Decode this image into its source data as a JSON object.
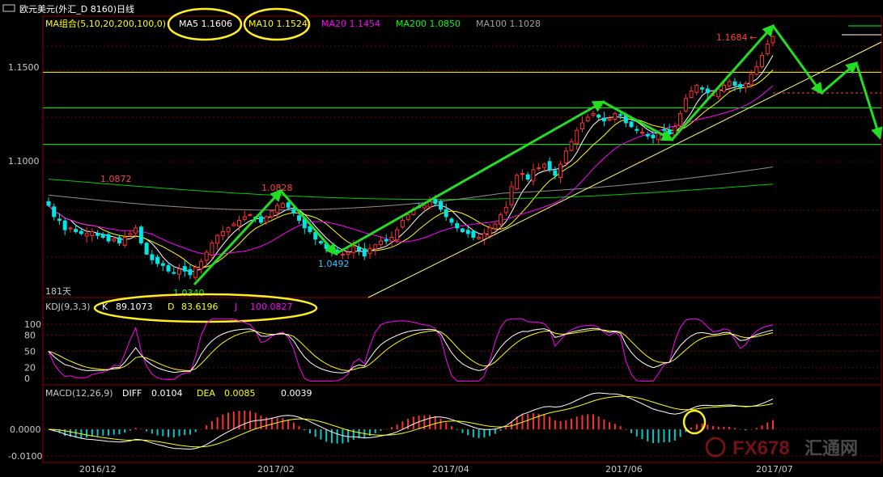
{
  "window": {
    "title": "欧元美元(外汇_D 8160)日线",
    "icon": "window-restore-icon"
  },
  "ma_legend": {
    "group_label": "MA组合(5,10,20,200,100,0)",
    "items": [
      {
        "label": "MA5",
        "value": "1.1606",
        "color": "#ffffff"
      },
      {
        "label": "MA10",
        "value": "1.1524",
        "color": "#ffff00"
      },
      {
        "label": "MA20",
        "value": "1.1454",
        "color": "#ff00ff"
      },
      {
        "label": "MA200",
        "value": "1.0850",
        "color": "#00ff00"
      },
      {
        "label": "MA100",
        "value": "1.1028",
        "color": "#a0a0a0"
      }
    ]
  },
  "price_axis": {
    "labels": [
      "1.1500",
      "1.1000"
    ],
    "label_values": [
      1.15,
      1.1
    ]
  },
  "period_label": "181天",
  "price_annotations": [
    {
      "text": "1.0872",
      "value": 1.0872,
      "date": "2016-12-20",
      "color": "#ff4040"
    },
    {
      "text": "1.0340",
      "value": 1.034,
      "date": "2017-01-03",
      "color": "#00ff00"
    },
    {
      "text": "1.0828",
      "value": 1.0828,
      "date": "2017-02-02",
      "color": "#ff4040"
    },
    {
      "text": "1.0492",
      "value": 1.0492,
      "date": "2017-02-22",
      "color": "#40c0ff"
    },
    {
      "text": "1.1684",
      "value": 1.1684,
      "date": "2017-07-03",
      "color": "#ff4040"
    }
  ],
  "horizontal_levels": [
    {
      "value": 1.149,
      "color": "#ffff00"
    },
    {
      "value": 1.13,
      "color": "#00ff00"
    },
    {
      "value": 1.1105,
      "color": "#00ff00"
    }
  ],
  "kdj": {
    "label": "KDJ(9,3,3)",
    "k_label": "K",
    "k_value": "89.1073",
    "d_label": "D",
    "d_value": "83.6196",
    "j_label": "J",
    "j_value": "100.0827",
    "axis_labels": [
      "100",
      "80",
      "50",
      "20",
      "0"
    ]
  },
  "macd": {
    "label": "MACD(12,26,9)",
    "diff_label": "DIFF",
    "diff_value": "0.0104",
    "dea_label": "DEA",
    "dea_value": "0.0085",
    "macd_value": "0.0039",
    "axis_labels": [
      "0.0000",
      "-0.0100"
    ]
  },
  "time_axis": {
    "labels": [
      "2016/12",
      "2017/02",
      "2017/04",
      "2017/06",
      "2017/07"
    ]
  },
  "watermark": {
    "text": "FX678",
    "text2": "汇通网",
    "logo": "fx678-logo-icon"
  },
  "chart_data": {
    "type": "candlestick",
    "title": "欧元美元(外汇_D 8160)日线",
    "instrument": "EUR/USD daily",
    "ylim": [
      1.029,
      1.176
    ],
    "key_points": [
      {
        "date": "2016-12-20",
        "value": 1.0872,
        "kind": "high"
      },
      {
        "date": "2017-01-03",
        "value": 1.034,
        "kind": "low"
      },
      {
        "date": "2017-02-02",
        "value": 1.0828,
        "kind": "high"
      },
      {
        "date": "2017-02-22",
        "value": 1.0492,
        "kind": "low"
      },
      {
        "date": "2017-05-16",
        "value": 1.13,
        "kind": "high"
      },
      {
        "date": "2017-06-08",
        "value": 1.112,
        "kind": "low"
      },
      {
        "date": "2017-07-03",
        "value": 1.1684,
        "kind": "high"
      }
    ],
    "closes": [
      1.078,
      1.072,
      1.07,
      1.065,
      1.066,
      1.064,
      1.063,
      1.063,
      1.064,
      1.062,
      1.061,
      1.059,
      1.06,
      1.058,
      1.061,
      1.063,
      1.066,
      1.058,
      1.052,
      1.049,
      1.047,
      1.046,
      1.043,
      1.042,
      1.044,
      1.043,
      1.041,
      1.045,
      1.048,
      1.053,
      1.058,
      1.062,
      1.064,
      1.066,
      1.068,
      1.07,
      1.072,
      1.073,
      1.071,
      1.069,
      1.072,
      1.075,
      1.078,
      1.079,
      1.077,
      1.074,
      1.07,
      1.066,
      1.064,
      1.06,
      1.058,
      1.055,
      1.053,
      1.053,
      1.052,
      1.053,
      1.056,
      1.054,
      1.051,
      1.055,
      1.057,
      1.059,
      1.059,
      1.061,
      1.065,
      1.07,
      1.073,
      1.076,
      1.077,
      1.078,
      1.08,
      1.079,
      1.076,
      1.072,
      1.069,
      1.066,
      1.064,
      1.063,
      1.061,
      1.061,
      1.063,
      1.066,
      1.068,
      1.073,
      1.077,
      1.088,
      1.094,
      1.095,
      1.092,
      1.097,
      1.098,
      1.1,
      1.097,
      1.094,
      1.1,
      1.107,
      1.112,
      1.118,
      1.122,
      1.125,
      1.127,
      1.125,
      1.123,
      1.124,
      1.127,
      1.126,
      1.122,
      1.12,
      1.118,
      1.117,
      1.115,
      1.114,
      1.117,
      1.118,
      1.116,
      1.12,
      1.127,
      1.135,
      1.139,
      1.142,
      1.14,
      1.138,
      1.137,
      1.14,
      1.142,
      1.144,
      1.142,
      1.141,
      1.143,
      1.148,
      1.152,
      1.158,
      1.164,
      1.168
    ],
    "annotation_arrows": "green trend arrows projecting up to ~1.17 then down toward ~1.11"
  }
}
